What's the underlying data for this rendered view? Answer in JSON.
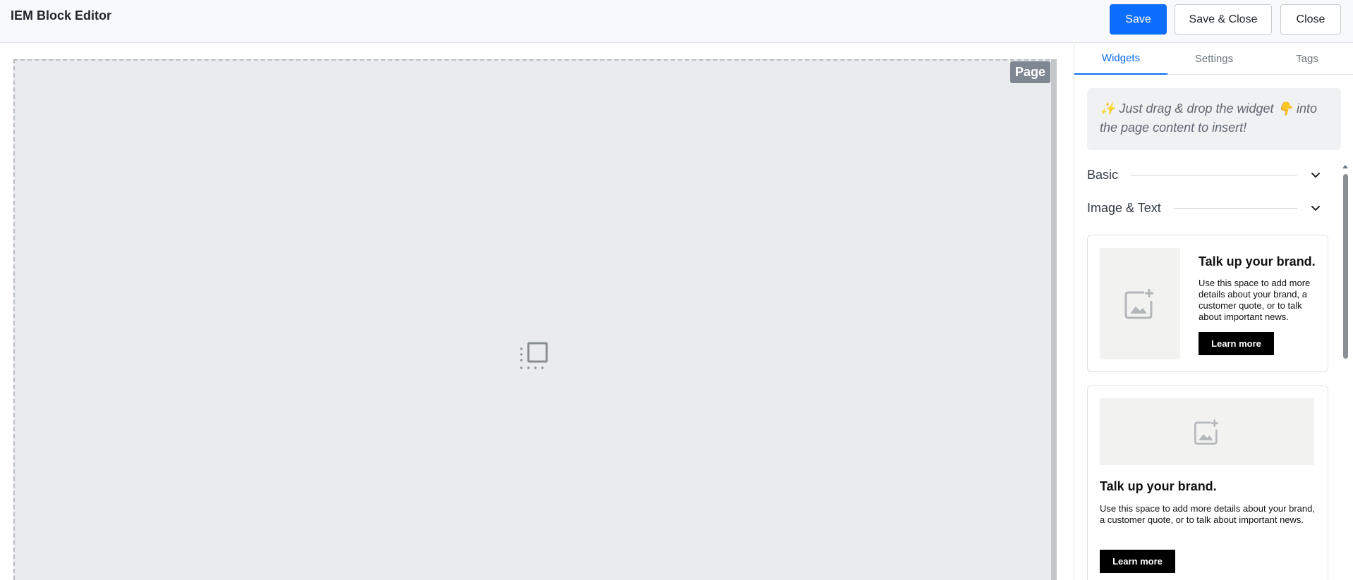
{
  "header": {
    "title": "IEM Block Editor",
    "save_label": "Save",
    "save_close_label": "Save & Close",
    "close_label": "Close"
  },
  "canvas": {
    "page_badge": "Page",
    "empty_icon": "frame-icon"
  },
  "sidebar": {
    "tabs": [
      {
        "label": "Widgets",
        "active": true
      },
      {
        "label": "Settings",
        "active": false
      },
      {
        "label": "Tags",
        "active": false
      }
    ],
    "hint": "✨ Just drag & drop the widget 👇 into the page content to insert!",
    "sections": [
      {
        "label": "Basic",
        "icon": "chevron-down-icon"
      },
      {
        "label": "Image & Text",
        "icon": "chevron-down-icon"
      }
    ],
    "widgets": [
      {
        "layout": "image-left",
        "title": "Talk up your brand.",
        "body": "Use this space to add more details about your brand, a customer quote, or to talk about important news.",
        "button": "Learn more",
        "icon": "add-image-icon"
      },
      {
        "layout": "image-top",
        "title": "Talk up your brand.",
        "body": "Use this space to add more details about your brand, a customer quote, or to talk about important news.",
        "button": "Learn more",
        "icon": "add-image-icon"
      }
    ]
  },
  "colors": {
    "accent": "#0d6efd",
    "canvas_bg": "#e9ebee",
    "badge_bg": "#7f8792"
  }
}
